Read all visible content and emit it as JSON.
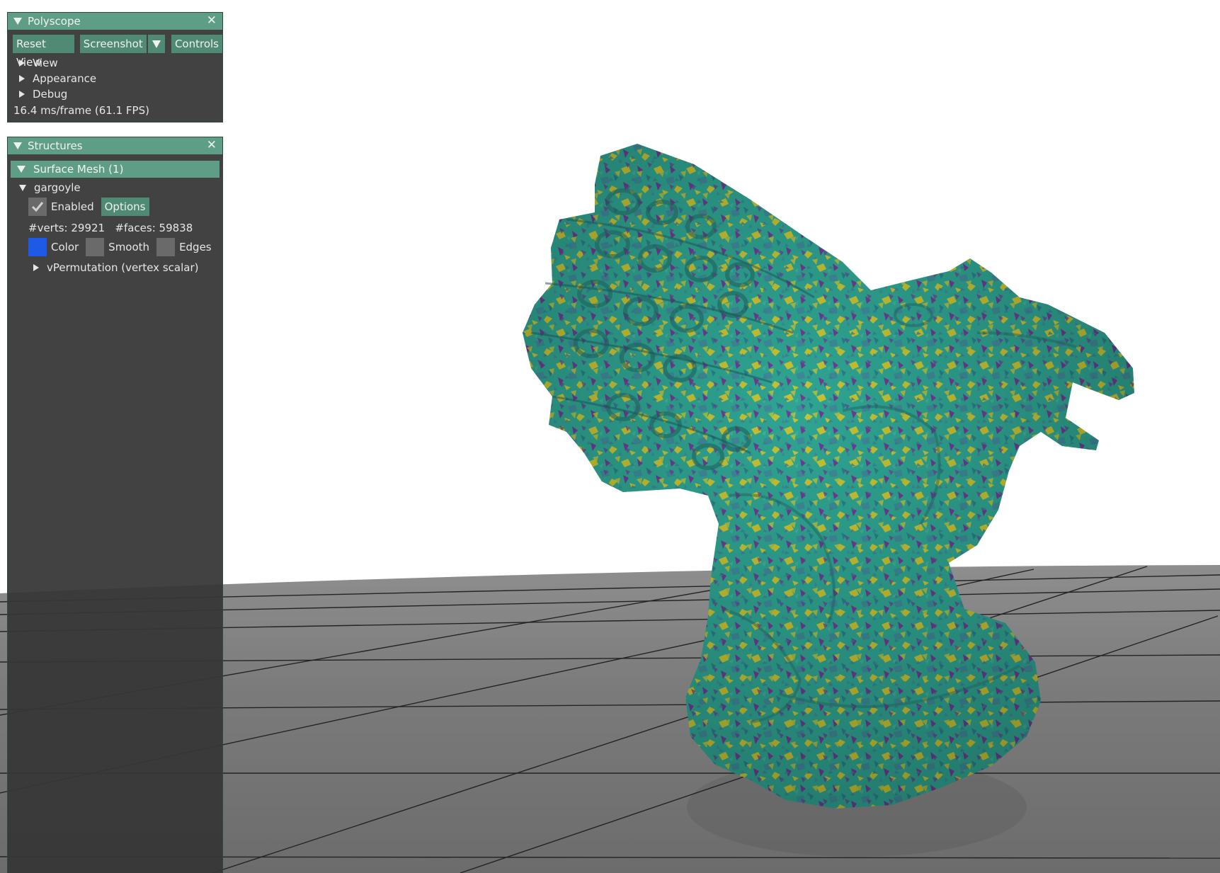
{
  "polyscope_panel": {
    "title": "Polyscope",
    "close_glyph": "✕",
    "buttons": {
      "reset_view": "Reset View",
      "screenshot": "Screenshot",
      "controls": "Controls"
    },
    "menu_items": [
      {
        "label": "View"
      },
      {
        "label": "Appearance"
      },
      {
        "label": "Debug"
      }
    ],
    "fps_text": "16.4 ms/frame (61.1 FPS)"
  },
  "structures_panel": {
    "title": "Structures",
    "close_glyph": "✕",
    "surface_mesh_header": "Surface Mesh (1)",
    "mesh": {
      "name": "gargoyle",
      "enabled_label": "Enabled",
      "options_label": "Options",
      "verts_text": "#verts: 29921",
      "faces_text": "#faces: 59838",
      "color_label": "Color",
      "smooth_label": "Smooth",
      "edges_label": "Edges",
      "quantity_label": "vPermutation (vertex scalar)"
    }
  },
  "colors": {
    "accent_header": "#5f9e86",
    "button": "#4f8a74",
    "panel_bg": "#363636",
    "mesh_color": "#1e5ae6",
    "mesh_primary": "#2fa592",
    "mesh_highlight": "#c6c334",
    "mesh_shadow": "#6e3c93"
  },
  "icons": {
    "collapse": "triangle-down-icon",
    "expand": "triangle-right-icon",
    "close": "close-icon",
    "check": "check-icon"
  }
}
